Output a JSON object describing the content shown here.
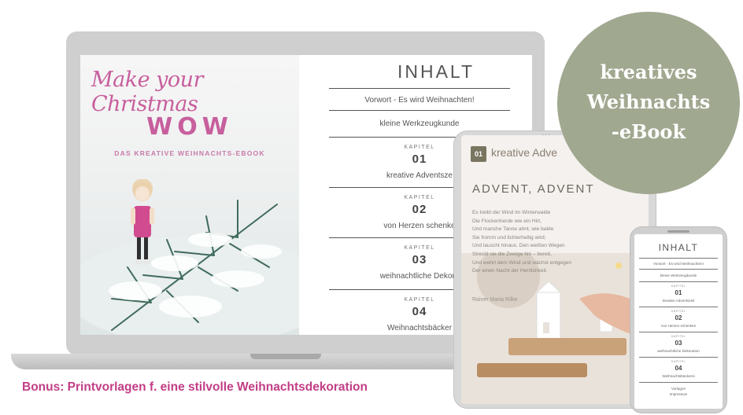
{
  "badge": {
    "lines": [
      "kreatives",
      "Weihnachts",
      "-eBook"
    ],
    "color": "#a1a890"
  },
  "cover": {
    "script_title": "Make your Christmas",
    "wow": "WOW",
    "subtitle": "DAS KREATIVE WEIHNACHTS-EBOOK",
    "accent_color": "#c75f9d"
  },
  "laptop_toc": {
    "title": "INHALT",
    "intro_items": [
      "Vorwort - Es wird Weihnachten!",
      "kleine Werkzeugkunde"
    ],
    "chapters": [
      {
        "kap": "KAPITEL",
        "num": "01",
        "label": "kreative Adventsze"
      },
      {
        "kap": "KAPITEL",
        "num": "02",
        "label": "von Herzen schenke"
      },
      {
        "kap": "KAPITEL",
        "num": "03",
        "label": "weihnachtliche Dekora"
      },
      {
        "kap": "KAPITEL",
        "num": "04",
        "label": "Weihnachtsbäcker"
      }
    ]
  },
  "tablet": {
    "chapter_num": "01",
    "chapter_label": "kreative Adve",
    "title": "ADVENT, ADVENT",
    "poem": [
      "Es treibt der Wind im Winterwalde",
      "Die Flockenherde wie ein Hirt,",
      "Und manche Tanne ahnt, wie balde",
      "Sie fromm und lichterheilig wird;",
      "Und lauscht hinaus. Den weißen Wegen",
      "Streckt sie die Zweige hin – bereit,",
      "Und wehrt dem Wind und wächst entgegen",
      "Der einen Nacht der Herrlichkeit."
    ],
    "author": "Rainer Maria Rilke"
  },
  "phone": {
    "title": "INHALT",
    "intro_items": [
      "Vorwort - Es wird Weihnachten!",
      "kleine Werkzeugkunde"
    ],
    "chapters": [
      {
        "kap": "KAPITEL",
        "num": "01",
        "label": "kreative Adventszeit"
      },
      {
        "kap": "KAPITEL",
        "num": "02",
        "label": "von Herzen schenken"
      },
      {
        "kap": "KAPITEL",
        "num": "03",
        "label": "weihnachtliche Dekoration"
      },
      {
        "kap": "KAPITEL",
        "num": "04",
        "label": "Weihnachtsbäckerei"
      }
    ],
    "footer_items": [
      "Vorlagen",
      "Impressum"
    ]
  },
  "bonus": {
    "text": "Bonus: Printvorlagen f. eine stilvolle Weihnachtsdekoration",
    "color": "#c23d86"
  }
}
